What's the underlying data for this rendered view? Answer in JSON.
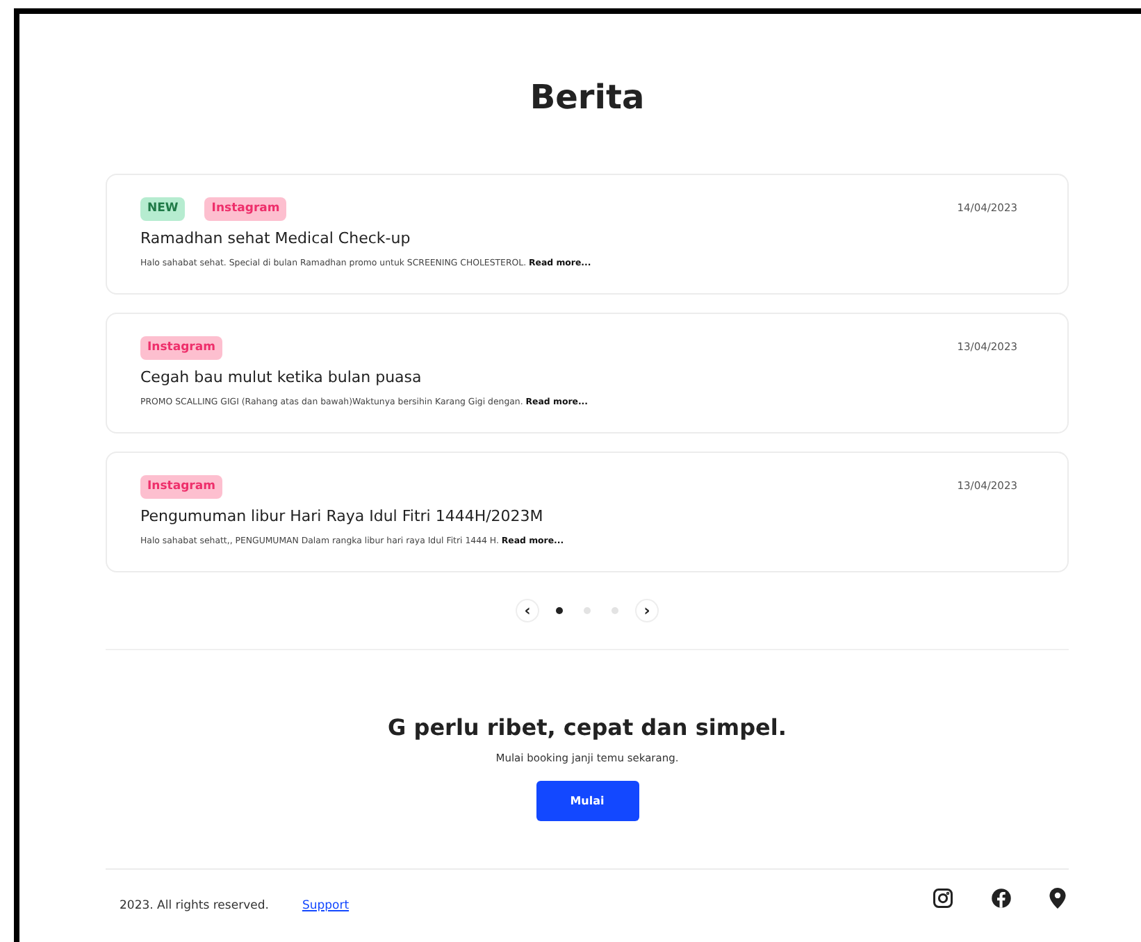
{
  "title": "Berita",
  "news": [
    {
      "tags": [
        {
          "kind": "new",
          "label": "NEW"
        },
        {
          "kind": "instagram",
          "label": "Instagram"
        }
      ],
      "date": "14/04/2023",
      "headline": "Ramadhan sehat Medical Check-up",
      "excerpt": "Halo sahabat sehat. Special di bulan Ramadhan promo untuk SCREENING CHOLESTEROL.",
      "link": "Read more..."
    },
    {
      "tags": [
        {
          "kind": "instagram",
          "label": "Instagram"
        }
      ],
      "date": "13/04/2023",
      "headline": "Cegah bau mulut ketika bulan puasa",
      "excerpt": "PROMO SCALLING GIGI (Rahang atas dan bawah)Waktunya bersihin Karang Gigi dengan.",
      "link": "Read more..."
    },
    {
      "tags": [
        {
          "kind": "instagram",
          "label": "Instagram"
        }
      ],
      "date": "13/04/2023",
      "headline": "Pengumuman libur Hari Raya Idul Fitri 1444H/2023M",
      "excerpt": "Halo sahabat sehatt,, PENGUMUMAN Dalam rangka libur hari raya Idul Fitri 1444 H.",
      "link": "Read more..."
    }
  ],
  "pager": {
    "prev": "‹",
    "next": "›",
    "dots": [
      {
        "selected": true
      },
      {
        "selected": false
      },
      {
        "selected": false
      }
    ]
  },
  "cta": {
    "heading": "G perlu ribet, cepat dan simpel.",
    "subtitle": "Mulai booking janji temu sekarang.",
    "button": "Mulai"
  },
  "footer": {
    "copyright": "2023. All rights reserved.",
    "link": "Support",
    "socials": [
      {
        "kind": "instagram"
      },
      {
        "kind": "facebook"
      },
      {
        "kind": "location"
      }
    ]
  }
}
